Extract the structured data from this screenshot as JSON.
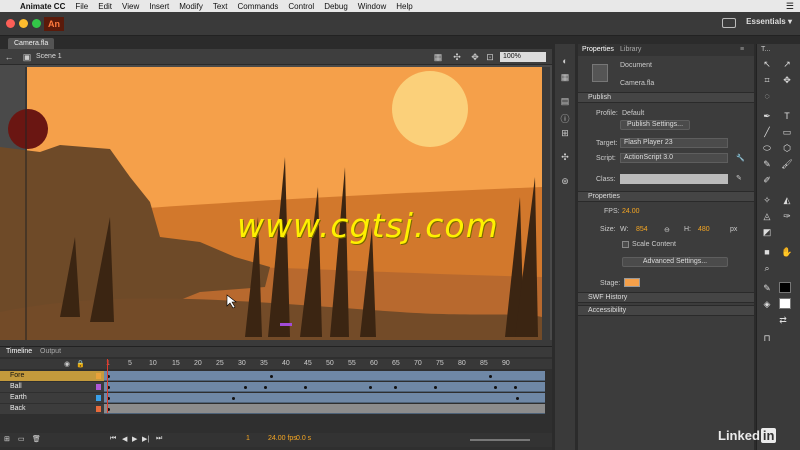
{
  "menubar": {
    "app_name": "Animate CC",
    "items": [
      "File",
      "Edit",
      "View",
      "Insert",
      "Modify",
      "Text",
      "Commands",
      "Control",
      "Debug",
      "Window",
      "Help"
    ]
  },
  "appbar": {
    "logo": "An",
    "workspace": "Essentials"
  },
  "document": {
    "tab_label": "Camera.fla",
    "scene_label": "Scene 1",
    "zoom": "100%"
  },
  "watermark": "www.cgtsj.com",
  "timeline": {
    "tabs": [
      "Timeline",
      "Output"
    ],
    "frame_numbers": [
      "1",
      "5",
      "10",
      "15",
      "20",
      "25",
      "30",
      "35",
      "40",
      "45",
      "50",
      "55",
      "60",
      "65",
      "70",
      "75",
      "80",
      "85",
      "90"
    ],
    "layers": [
      {
        "name": "Fore",
        "color": "#e8a13a"
      },
      {
        "name": "Ball",
        "color": "#b058d8"
      },
      {
        "name": "Earth",
        "color": "#3aa0e8"
      },
      {
        "name": "Back",
        "color": "#e86a3a"
      }
    ],
    "current_frame": "1",
    "fps": "24.00 fps",
    "time": "0.0 s"
  },
  "properties": {
    "tabs": [
      "Properties",
      "Library"
    ],
    "doc_label": "Document",
    "doc_name": "Camera.fla",
    "publish": {
      "section": "Publish",
      "profile_label": "Profile:",
      "profile_value": "Default",
      "settings_button": "Publish Settings...",
      "target_label": "Target:",
      "target_value": "Flash Player 23",
      "script_label": "Script:",
      "script_value": "ActionScript 3.0",
      "class_label": "Class:"
    },
    "props": {
      "section": "Properties",
      "fps_label": "FPS:",
      "fps_value": "24.00",
      "size_label": "Size:",
      "w_label": "W:",
      "w_value": "854",
      "h_label": "H:",
      "h_value": "480",
      "unit": "px",
      "scale_label": "Scale Content",
      "advanced_button": "Advanced Settings...",
      "stage_label": "Stage:",
      "stage_color": "#f5a04a"
    },
    "swf_history": "SWF History",
    "accessibility": "Accessibility"
  },
  "tools_title": "T...",
  "linkedin": {
    "text": "Linked",
    "in": "in"
  }
}
